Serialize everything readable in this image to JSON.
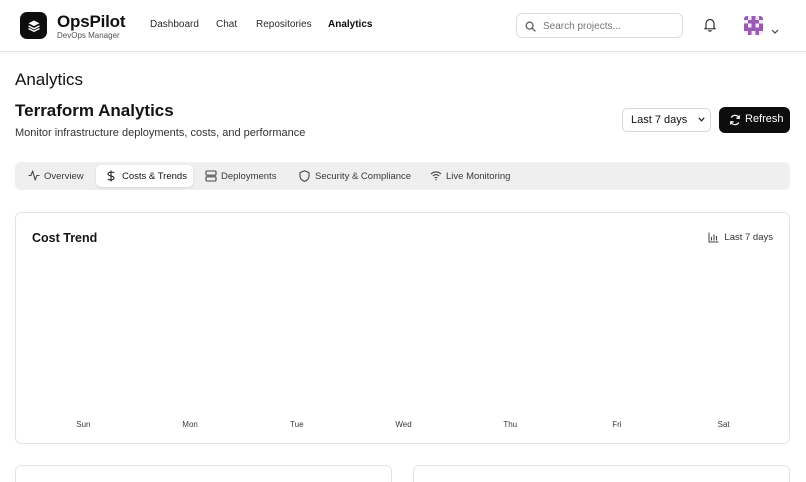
{
  "brand": {
    "name": "OpsPilot",
    "subtitle": "DevOps Manager"
  },
  "nav": [
    {
      "label": "Dashboard",
      "active": false
    },
    {
      "label": "Chat",
      "active": false
    },
    {
      "label": "Repositories",
      "active": false
    },
    {
      "label": "Analytics",
      "active": true
    }
  ],
  "search": {
    "placeholder": "Search projects...",
    "value": ""
  },
  "page": {
    "title": "Analytics",
    "section_title": "Terraform Analytics",
    "section_subtitle": "Monitor infrastructure deployments, costs, and performance",
    "range_selected": "Last 7 days",
    "refresh_label": "Refresh"
  },
  "tabs": [
    {
      "label": "Overview",
      "icon": "activity-icon",
      "active": false
    },
    {
      "label": "Costs & Trends",
      "icon": "dollar-icon",
      "active": true
    },
    {
      "label": "Deployments",
      "icon": "server-icon",
      "active": false
    },
    {
      "label": "Security & Compliance",
      "icon": "shield-icon",
      "active": false
    },
    {
      "label": "Live Monitoring",
      "icon": "wifi-icon",
      "active": false
    }
  ],
  "cost_card": {
    "title": "Cost Trend",
    "range_label": "Last 7 days"
  },
  "chart_data": {
    "type": "bar",
    "title": "Cost Trend",
    "categories": [
      "Sun",
      "Mon",
      "Tue",
      "Wed",
      "Thu",
      "Fri",
      "Sat"
    ],
    "series": [
      {
        "values": [
          0,
          0,
          0,
          0,
          0,
          0,
          0
        ]
      }
    ],
    "xlabel": "",
    "ylabel": "",
    "grid": false,
    "legend": "none"
  },
  "colors": {
    "accent": "#0d0d0d",
    "tab_bg": "#efefef",
    "avatar": "#9b59b6"
  }
}
